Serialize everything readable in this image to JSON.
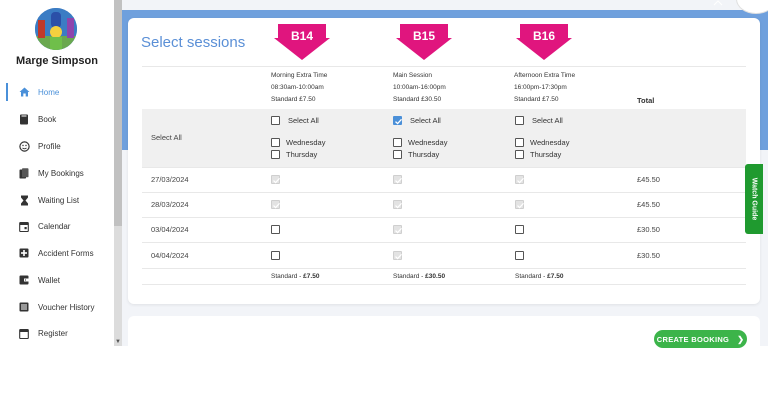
{
  "user": {
    "name": "Marge Simpson"
  },
  "nav": [
    {
      "label": "Home",
      "icon": "home-icon",
      "active": true
    },
    {
      "label": "Book",
      "icon": "book-icon"
    },
    {
      "label": "Profile",
      "icon": "profile-icon"
    },
    {
      "label": "My Bookings",
      "icon": "bookings-icon"
    },
    {
      "label": "Waiting List",
      "icon": "hourglass-icon"
    },
    {
      "label": "Calendar",
      "icon": "calendar-icon"
    },
    {
      "label": "Accident Forms",
      "icon": "medical-cross-icon"
    },
    {
      "label": "Wallet",
      "icon": "wallet-icon"
    },
    {
      "label": "Voucher History",
      "icon": "list-icon"
    },
    {
      "label": "Register",
      "icon": "register-icon"
    }
  ],
  "page": {
    "title": "Select sessions"
  },
  "sessions": [
    {
      "badge": "B14",
      "name": "Morning Extra Time",
      "time": "08:30am-10:00am",
      "price": "Standard £7.50",
      "footer_label": "Standard - ",
      "footer_price": "£7.50"
    },
    {
      "badge": "B15",
      "name": "Main Session",
      "time": "10:00am-16:00pm",
      "price": "Standard £30.50",
      "footer_label": "Standard - ",
      "footer_price": "£30.50"
    },
    {
      "badge": "B16",
      "name": "Afternoon Extra Time",
      "time": "16:00pm-17:30pm",
      "price": "Standard £7.50",
      "footer_label": "Standard - ",
      "footer_price": "£7.50"
    }
  ],
  "table": {
    "total_header": "Total",
    "select_all_row_label": "Select All",
    "select_all_label": "Select All",
    "day_options": [
      "Wednesday",
      "Thursday"
    ],
    "rows": [
      {
        "date": "27/03/2024",
        "total": "£45.50"
      },
      {
        "date": "28/03/2024",
        "total": "£45.50"
      },
      {
        "date": "03/04/2024",
        "total": "£30.50"
      },
      {
        "date": "04/04/2024",
        "total": "£30.50"
      }
    ]
  },
  "actions": {
    "create_booking": "CREATE BOOKING",
    "watch_guide": "Watch Guide"
  },
  "colors": {
    "accent": "#5a8fd6",
    "badge": "#e0157e",
    "create": "#3cb44a",
    "watch": "#1f9a2f",
    "header_bg": "#6fa0dd"
  }
}
